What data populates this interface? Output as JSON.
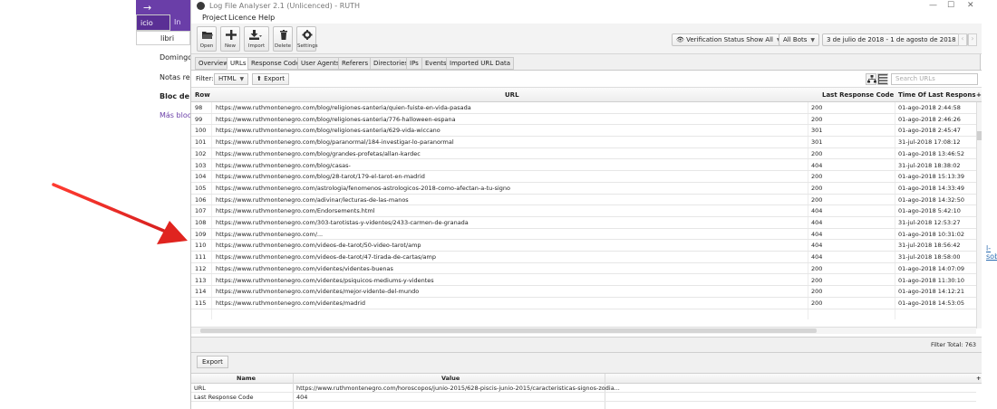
{
  "browser": {
    "tab_active": "icio",
    "tab_next": "In",
    "search_value": "libri",
    "rows": [
      "Domingo G",
      "Notas recie",
      "Bloc de not",
      "Más blocs"
    ],
    "right_link": "l-sob"
  },
  "window": {
    "title": "Log File Analyser 2.1 (Unlicenced) - RUTH",
    "minimize": "—",
    "maximize": "☐",
    "close": "✕"
  },
  "menu": [
    "Project",
    "Licence",
    "Help"
  ],
  "toolbar": {
    "open": "Open",
    "new": "New",
    "import": "Import",
    "delete": "Delete",
    "settings": "Settings",
    "verification": "Verification Status Show All",
    "bots": "All Bots",
    "date_range": "3 de julio de 2018 - 1 de agosto de 2018",
    "prev": "‹",
    "next": "›"
  },
  "tabs": [
    "Overview",
    "URLs",
    "Response Codes",
    "User Agents",
    "Referers",
    "Directories",
    "IPs",
    "Events",
    "Imported URL Data"
  ],
  "active_tab": "URLs",
  "filter": {
    "label": "Filter:",
    "value": "HTML",
    "export": "Export",
    "search_placeholder": "Search URLs"
  },
  "grid": {
    "columns": [
      "Row",
      "URL",
      "Last Response Code",
      "Time Of Last Respons"
    ],
    "rows": [
      {
        "row": "98",
        "url": "https://www.ruthmontenegro.com/blog/religiones-santeria/quien-fuiste-en-vida-pasada",
        "code": "200",
        "time": "01-ago-2018 2:44:58"
      },
      {
        "row": "99",
        "url": "https://www.ruthmontenegro.com/blog/religiones-santeria/776-halloween-espana",
        "code": "200",
        "time": "01-ago-2018 2:46:26"
      },
      {
        "row": "100",
        "url": "https://www.ruthmontenegro.com/blog/religiones-santeria/629-vida-wiccano",
        "code": "301",
        "time": "01-ago-2018 2:45:47"
      },
      {
        "row": "101",
        "url": "https://www.ruthmontenegro.com/blog/paranormal/184-investigar-lo-paranormal",
        "code": "301",
        "time": "31-jul-2018 17:08:12"
      },
      {
        "row": "102",
        "url": "https://www.ruthmontenegro.com/blog/grandes-profetas/allan-kardec",
        "code": "200",
        "time": "01-ago-2018 13:46:52"
      },
      {
        "row": "103",
        "url": "https://www.ruthmontenegro.com/blog/casas-",
        "code": "404",
        "time": "31-jul-2018 18:38:02"
      },
      {
        "row": "104",
        "url": "https://www.ruthmontenegro.com/blog/28-tarot/179-el-tarot-en-madrid",
        "code": "200",
        "time": "01-ago-2018 15:13:39"
      },
      {
        "row": "105",
        "url": "https://www.ruthmontenegro.com/astrologia/fenomenos-astrologicos-2018-como-afectan-a-tu-signo",
        "code": "200",
        "time": "01-ago-2018 14:33:49"
      },
      {
        "row": "106",
        "url": "https://www.ruthmontenegro.com/adivinar/lecturas-de-las-manos",
        "code": "200",
        "time": "01-ago-2018 14:32:50"
      },
      {
        "row": "107",
        "url": "https://www.ruthmontenegro.com/Endorsements.html",
        "code": "404",
        "time": "01-ago-2018 5:42:10"
      },
      {
        "row": "108",
        "url": "https://www.ruthmontenegro.com/303-tarotistas-y-videntes/2433-carmen-de-granada",
        "code": "404",
        "time": "31-jul-2018 12:53:27"
      },
      {
        "row": "109",
        "url": "https://www.ruthmontenegro.com/...",
        "code": "404",
        "time": "01-ago-2018 10:31:02"
      },
      {
        "row": "110",
        "url": "https://www.ruthmontenegro.com/videos-de-tarot/50-video-tarot/amp",
        "code": "404",
        "time": "31-jul-2018 18:56:42"
      },
      {
        "row": "111",
        "url": "https://www.ruthmontenegro.com/videos-de-tarot/47-tirada-de-cartas/amp",
        "code": "404",
        "time": "31-jul-2018 18:58:00"
      },
      {
        "row": "112",
        "url": "https://www.ruthmontenegro.com/videntes/videntes-buenas",
        "code": "200",
        "time": "01-ago-2018 14:07:09"
      },
      {
        "row": "113",
        "url": "https://www.ruthmontenegro.com/videntes/psiquicos-mediums-y-videntes",
        "code": "200",
        "time": "01-ago-2018 11:30:10"
      },
      {
        "row": "114",
        "url": "https://www.ruthmontenegro.com/videntes/mejor-vidente-del-mundo",
        "code": "200",
        "time": "01-ago-2018 14:12:21"
      },
      {
        "row": "115",
        "url": "https://www.ruthmontenegro.com/videntes/madrid",
        "code": "200",
        "time": "01-ago-2018 14:53:05"
      }
    ]
  },
  "status": {
    "filter_total": "Filter Total: 763"
  },
  "details": {
    "export": "Export",
    "columns": [
      "Name",
      "Value"
    ],
    "rows": [
      {
        "name": "URL",
        "value": "https://www.ruthmontenegro.com/horoscopos/junio-2015/628-piscis-junio-2015/caracteristicas-signos-zodia..."
      },
      {
        "name": "Last Response Code",
        "value": "404"
      }
    ]
  }
}
